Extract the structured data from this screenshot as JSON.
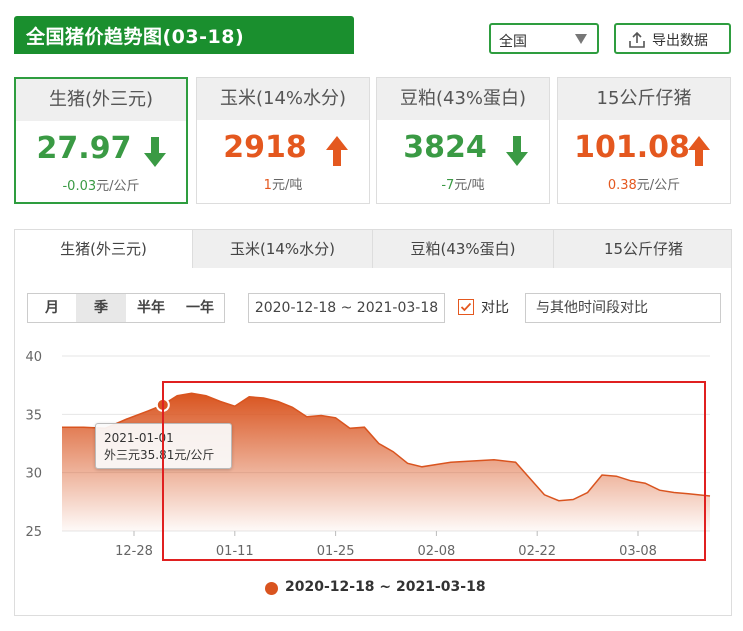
{
  "header": {
    "title": "全国猪价趋势图(03-18)",
    "region_value": "全国",
    "export_label": "导出数据"
  },
  "cards": [
    {
      "name": "生猪(外三元)",
      "price": "27.97",
      "change": "-0.03",
      "unit": "元/公斤",
      "trend": "down"
    },
    {
      "name": "玉米(14%水分)",
      "price": "2918",
      "change": "1",
      "unit": "元/吨",
      "trend": "up"
    },
    {
      "name": "豆粕(43%蛋白)",
      "price": "3824",
      "change": "-7",
      "unit": "元/吨",
      "trend": "down"
    },
    {
      "name": "15公斤仔猪",
      "price": "101.08",
      "change": "0.38",
      "unit": "元/公斤",
      "trend": "up"
    }
  ],
  "colors": {
    "green": "#3a9a44",
    "red": "#e4581f",
    "series": "#d9541f",
    "highlight": "#e02020"
  },
  "tabs": [
    "生猪(外三元)",
    "玉米(14%水分)",
    "豆粕(43%蛋白)",
    "15公斤仔猪"
  ],
  "range_buttons": [
    "月",
    "季",
    "半年",
    "一年"
  ],
  "date_range": "2020-12-18 ~ 2021-03-18",
  "compare": {
    "label": "对比",
    "checked": true,
    "placeholder": "与其他时间段对比"
  },
  "tooltip": {
    "date": "2021-01-01",
    "value_text": "外三元35.81元/公斤"
  },
  "chart_data": {
    "type": "area",
    "ylim": [
      25,
      40
    ],
    "yticks": [
      25,
      30,
      35,
      40
    ],
    "xticks": [
      "12-28",
      "01-11",
      "01-25",
      "02-08",
      "02-22",
      "03-08"
    ],
    "series": [
      {
        "name": "2020-12-18 ~ 2021-03-18",
        "x": [
          "2020-12-18",
          "2020-12-21",
          "2020-12-24",
          "2020-12-27",
          "2020-12-30",
          "2021-01-01",
          "2021-01-03",
          "2021-01-05",
          "2021-01-07",
          "2021-01-09",
          "2021-01-11",
          "2021-01-13",
          "2021-01-15",
          "2021-01-17",
          "2021-01-19",
          "2021-01-21",
          "2021-01-23",
          "2021-01-25",
          "2021-01-27",
          "2021-01-29",
          "2021-01-31",
          "2021-02-02",
          "2021-02-04",
          "2021-02-06",
          "2021-02-08",
          "2021-02-10",
          "2021-02-13",
          "2021-02-16",
          "2021-02-19",
          "2021-02-21",
          "2021-02-23",
          "2021-02-25",
          "2021-02-27",
          "2021-03-01",
          "2021-03-03",
          "2021-03-05",
          "2021-03-07",
          "2021-03-09",
          "2021-03-11",
          "2021-03-13",
          "2021-03-15",
          "2021-03-18"
        ],
        "values": [
          33.9,
          33.9,
          33.8,
          34.6,
          35.3,
          35.81,
          36.6,
          36.8,
          36.6,
          36.1,
          35.7,
          36.5,
          36.4,
          36.1,
          35.6,
          34.8,
          34.9,
          34.7,
          33.8,
          33.9,
          32.5,
          31.8,
          30.8,
          30.5,
          30.7,
          30.9,
          31.0,
          31.1,
          30.9,
          29.5,
          28.1,
          27.6,
          27.7,
          28.3,
          29.8,
          29.7,
          29.3,
          29.1,
          28.5,
          28.3,
          28.2,
          28.0
        ]
      }
    ],
    "highlight_point": {
      "x": "2021-01-01",
      "y": 35.81
    },
    "legend_position": "bottom",
    "grid": true
  }
}
